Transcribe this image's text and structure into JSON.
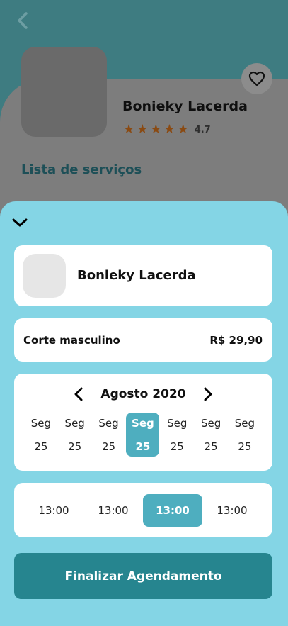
{
  "colors": {
    "sheet_bg": "#84d5e5",
    "accent": "#4eaebf",
    "primary_button": "#26858f",
    "star": "#8a4a12"
  },
  "background_page": {
    "back_icon": "chevron-left-icon",
    "favorite_icon": "heart-outline-icon",
    "professional_name": "Bonieky Lacerda",
    "stars": 5,
    "rating": "4.7",
    "services_title": "Lista de serviços"
  },
  "sheet": {
    "collapse_icon": "chevron-down-icon",
    "professional": {
      "name": "Bonieky Lacerda"
    },
    "service": {
      "name": "Corte masculino",
      "price": "R$ 29,90"
    },
    "calendar": {
      "month": "Agosto 2020",
      "prev_icon": "chevron-left-icon",
      "next_icon": "chevron-right-icon",
      "days": [
        {
          "name": "Seg",
          "number": "25"
        },
        {
          "name": "Seg",
          "number": "25"
        },
        {
          "name": "Seg",
          "number": "25"
        },
        {
          "name": "Seg",
          "number": "25"
        },
        {
          "name": "Seg",
          "number": "25"
        },
        {
          "name": "Seg",
          "number": "25"
        },
        {
          "name": "Seg",
          "number": "25"
        }
      ],
      "selected_day_index": 3
    },
    "times": [
      "13:00",
      "13:00",
      "13:00",
      "13:00"
    ],
    "selected_time_index": 2,
    "finish_label": "Finalizar Agendamento"
  }
}
